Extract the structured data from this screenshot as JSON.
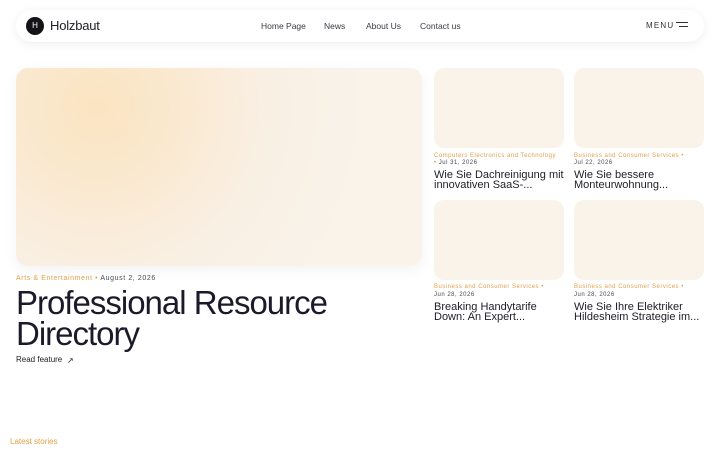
{
  "brand": {
    "logo_letter": "H",
    "name": "Holzbaut"
  },
  "nav": {
    "links": [
      "Home Page",
      "News",
      "About Us",
      "Contact us"
    ],
    "menu_label": "MENU"
  },
  "hero": {
    "category": "Arts & Entertainment",
    "separator": "•",
    "date": "August 2, 2026",
    "title": "Professional Resource Directory",
    "read_more": "Read feature",
    "arrow": "↗"
  },
  "cards": [
    {
      "category": "Computers Electronics and Technology",
      "date": "Jul 31, 2026",
      "title_line1": "Wie Sie Dachreinigung mit",
      "title_line2": "innovativen SaaS-..."
    },
    {
      "category": "Business and Consumer Services",
      "date": "Jul 22, 2026",
      "title_line1": "Wie Sie bessere",
      "title_line2": "Monteurwohnung..."
    },
    {
      "category": "Business and Consumer Services",
      "date": "Jun 28, 2026",
      "title_line1": "Breaking Handytarife",
      "title_line2": "Down: An Expert..."
    },
    {
      "category": "Business and Consumer Services",
      "date": "Jun 28, 2026",
      "title_line1": "Wie Sie Ihre Elektriker",
      "title_line2": "Hildesheim Strategie im..."
    }
  ],
  "separator": "•",
  "latest_label": "Latest stories",
  "colors": {
    "accent": "#e2a04a",
    "text": "#1d1d27",
    "card_bg": "#f9f3ea"
  }
}
